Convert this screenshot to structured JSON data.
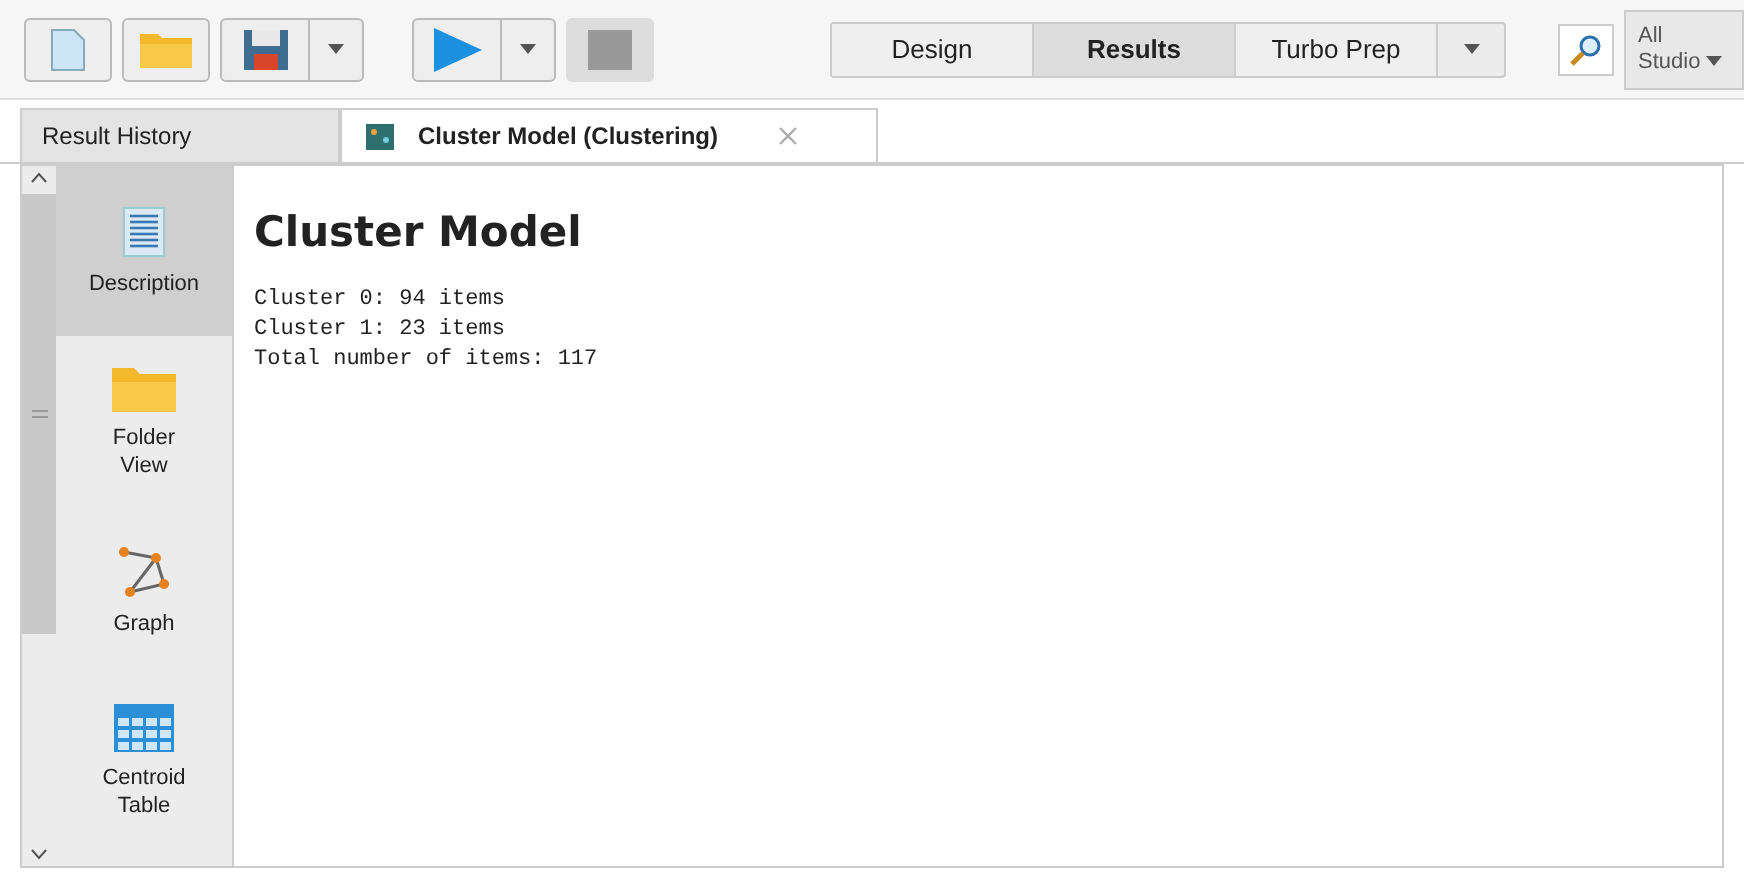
{
  "toolbar": {
    "perspectives": [
      {
        "label": "Design",
        "selected": false
      },
      {
        "label": "Results",
        "selected": true
      },
      {
        "label": "Turbo Prep",
        "selected": false
      }
    ],
    "scope": "All\nStudio"
  },
  "tabs": [
    {
      "label": "Result History",
      "selected": false,
      "closable": false
    },
    {
      "label": "Cluster Model (Clustering)",
      "selected": true,
      "closable": true
    }
  ],
  "views": [
    {
      "kind": "document",
      "label": "Description",
      "selected": true
    },
    {
      "kind": "folder",
      "label": "Folder\nView",
      "selected": false
    },
    {
      "kind": "graph",
      "label": "Graph",
      "selected": false
    },
    {
      "kind": "table",
      "label": "Centroid\nTable",
      "selected": false
    }
  ],
  "content": {
    "title": "Cluster Model",
    "lines": [
      "Cluster 0: 94 items",
      "Cluster 1: 23 items",
      "Total number of items: 117"
    ]
  }
}
